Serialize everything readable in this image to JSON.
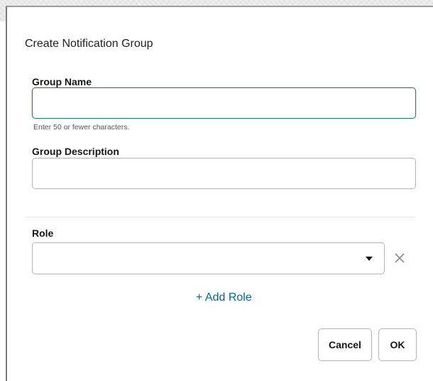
{
  "dialog": {
    "title": "Create Notification Group"
  },
  "fields": {
    "group_name": {
      "label": "Group Name",
      "value": "",
      "placeholder": "",
      "helper": "Enter 50 or fewer characters."
    },
    "group_description": {
      "label": "Group Description",
      "value": "",
      "placeholder": ""
    },
    "role": {
      "label": "Role",
      "selected": ""
    }
  },
  "actions": {
    "add_role": "+ Add Role",
    "cancel": "Cancel",
    "ok": "OK"
  },
  "icons": {
    "dropdown": "chevron-down-icon",
    "remove": "close-icon"
  },
  "colors": {
    "accent_link": "#04668d",
    "focus_border": "#2f7c4e"
  }
}
